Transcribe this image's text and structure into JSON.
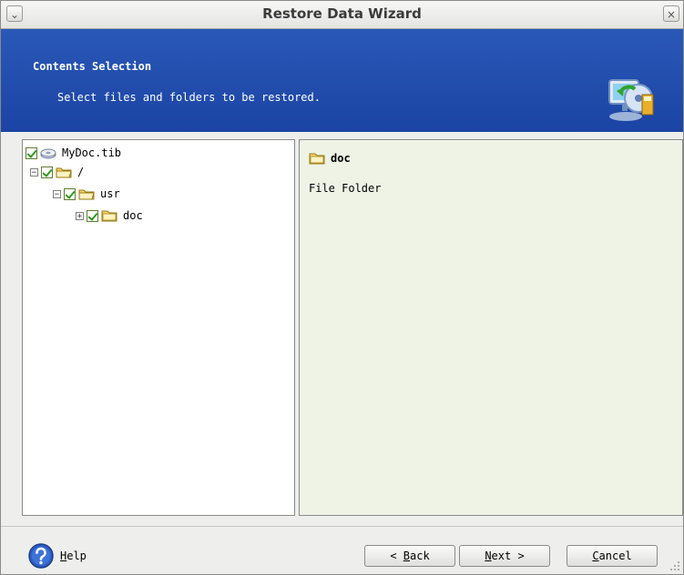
{
  "window": {
    "title": "Restore Data Wizard",
    "menu_glyph": "⌄",
    "close_glyph": "×"
  },
  "banner": {
    "title": "Contents Selection",
    "subtitle": "Select files and folders to be restored.",
    "icon": "restore-wizard-icon"
  },
  "tree": {
    "items": [
      {
        "label": "MyDoc.tib",
        "icon": "archive-icon",
        "checked": true,
        "expander": ""
      },
      {
        "label": "/",
        "icon": "folder-open-icon",
        "checked": true,
        "expander": "−"
      },
      {
        "label": "usr",
        "icon": "folder-open-icon",
        "checked": true,
        "expander": "−"
      },
      {
        "label": "doc",
        "icon": "folder-icon",
        "checked": true,
        "expander": "+"
      }
    ]
  },
  "details": {
    "name": "doc",
    "type": "File Folder",
    "icon": "folder-icon"
  },
  "footer": {
    "help_label": "Help",
    "help_mnemonic": "H",
    "help_rest": "elp",
    "back_prefix": "< ",
    "back_mnemonic": "B",
    "back_rest": "ack",
    "next_mnemonic": "N",
    "next_rest": "ext >",
    "cancel_mnemonic": "C",
    "cancel_rest": "ancel"
  },
  "colors": {
    "banner_bg": "#1f4aa8",
    "checkmark": "#2e9a1e",
    "folder": "#f0c040",
    "detail_bg": "#eef3e6"
  }
}
